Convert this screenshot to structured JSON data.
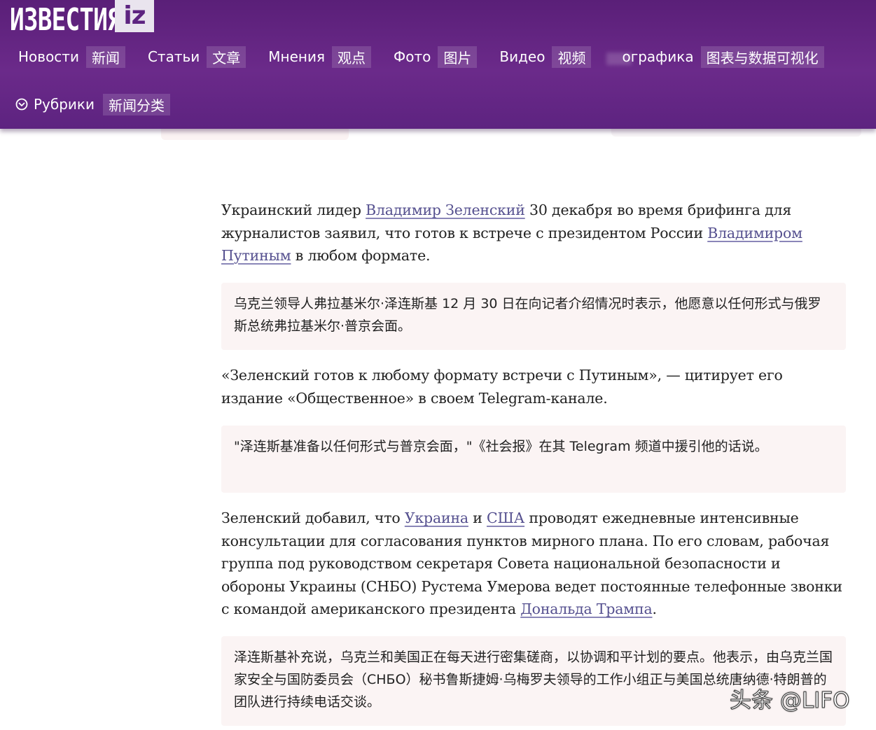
{
  "header": {
    "logo_text": "ИЗВЕСТИЯ",
    "logo_badge": "iz",
    "nav": [
      {
        "ru": "Новости",
        "zh": "新闻"
      },
      {
        "ru": "Статьи",
        "zh": "文章"
      },
      {
        "ru": "Мнения",
        "zh": "观点"
      },
      {
        "ru": "Фото",
        "zh": "图片"
      },
      {
        "ru": "Видео",
        "zh": "视频"
      },
      {
        "ru": "ографика",
        "zh": "图表与数据可视化"
      }
    ],
    "rubrics": {
      "ru": "Рубрики",
      "zh": "新闻分类"
    }
  },
  "article": {
    "p1": {
      "t1": "Украинский лидер ",
      "link1": "Владимир Зеленский",
      "t2": " 30 декабря во время брифинга для журналистов заявил, что готов к встрече с президентом России ",
      "link2": "Владимиром Путиным",
      "t3": " в любом формате."
    },
    "b1": "乌克兰领导人弗拉基米尔·泽连斯基 12 月 30 日在向记者介绍情况时表示，他愿意以任何形式与俄罗斯总统弗拉基米尔·普京会面。",
    "p2": "«Зеленский готов к любому формату встречи с Путиным», — цитирует его издание «Общественное» в своем Telegram-канале.",
    "b2": "\"泽连斯基准备以任何形式与普京会面，\"《社会报》在其 Telegram 频道中援引他的话说。",
    "p3": {
      "t1": "Зеленский добавил, что ",
      "link1": "Украина",
      "t2": " и ",
      "link2": "США",
      "t3": " проводят ежедневные интенсивные консультации для согласования пунктов мирного плана. По его словам, рабочая группа под руководством секретаря Совета национальной безопасности и обороны Украины (СНБО) Рустема Умерова ведет постоянные телефонные звонки с командой американского президента ",
      "link3": "Дональда Трампа",
      "t4": "."
    },
    "b3": "泽连斯基补充说，乌克兰和美国正在每天进行密集磋商，以协调和平计划的要点。他表示，由乌克兰国家安全与国防委员会（СНБО）秘书鲁斯捷姆·乌梅罗夫领导的工作小组正与美国总统唐纳德·特朗普的团队进行持续电话交谈。"
  },
  "watermark": "头条 @LIFO",
  "colors": {
    "header": "#6b2a8a",
    "link": "#55508f",
    "box": "#fbf4f4"
  }
}
